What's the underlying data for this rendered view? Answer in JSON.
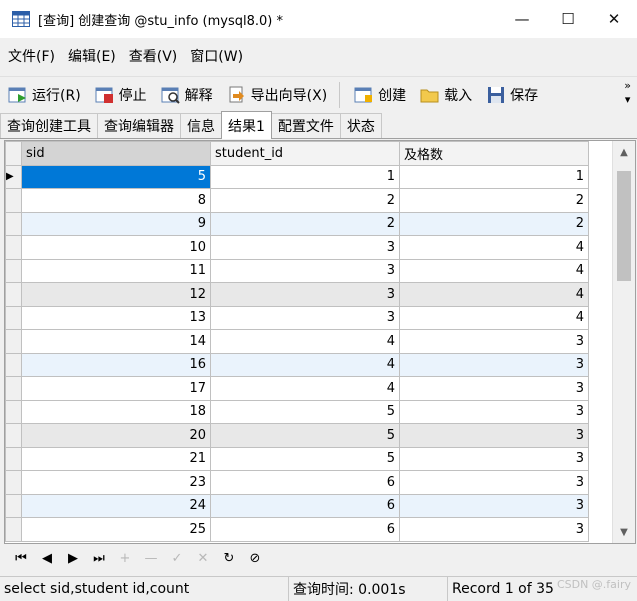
{
  "window": {
    "title": "[查询] 创建查询 @stu_info (mysql8.0) *",
    "controls": {
      "minimize": "—",
      "maximize": "☐",
      "close": "✕"
    }
  },
  "menu": [
    {
      "label": "文件(F)"
    },
    {
      "label": "编辑(E)"
    },
    {
      "label": "查看(V)"
    },
    {
      "label": "窗口(W)"
    }
  ],
  "toolbar": {
    "run": "运行(R)",
    "stop": "停止",
    "explain": "解释",
    "export_wizard": "导出向导(X)",
    "create": "创建",
    "load": "载入",
    "save": "保存",
    "more": "»"
  },
  "tabs": [
    {
      "label": "查询创建工具"
    },
    {
      "label": "查询编辑器"
    },
    {
      "label": "信息"
    },
    {
      "label": "结果1"
    },
    {
      "label": "配置文件"
    },
    {
      "label": "状态"
    }
  ],
  "active_tab": "结果1",
  "grid": {
    "columns": [
      "sid",
      "student_id",
      "及格数"
    ],
    "rows": [
      [
        "5",
        "1",
        "1"
      ],
      [
        "8",
        "2",
        "2"
      ],
      [
        "9",
        "2",
        "2"
      ],
      [
        "10",
        "3",
        "4"
      ],
      [
        "11",
        "3",
        "4"
      ],
      [
        "12",
        "3",
        "4"
      ],
      [
        "13",
        "3",
        "4"
      ],
      [
        "14",
        "4",
        "3"
      ],
      [
        "16",
        "4",
        "3"
      ],
      [
        "17",
        "4",
        "3"
      ],
      [
        "18",
        "5",
        "3"
      ],
      [
        "20",
        "5",
        "3"
      ],
      [
        "21",
        "5",
        "3"
      ],
      [
        "23",
        "6",
        "3"
      ],
      [
        "24",
        "6",
        "3"
      ],
      [
        "25",
        "6",
        "3"
      ]
    ]
  },
  "navigation": {
    "first": "⏮",
    "prev": "◀",
    "next": "▶",
    "last": "⏭",
    "add": "+",
    "delete": "—",
    "apply": "✓",
    "cancel": "✕",
    "refresh": "↻",
    "stop": "⊘"
  },
  "status": {
    "sql": "select sid,student id,count",
    "query_time": "查询时间: 0.001s",
    "record": "Record 1 of 35"
  },
  "watermark": "CSDN @.fairy"
}
